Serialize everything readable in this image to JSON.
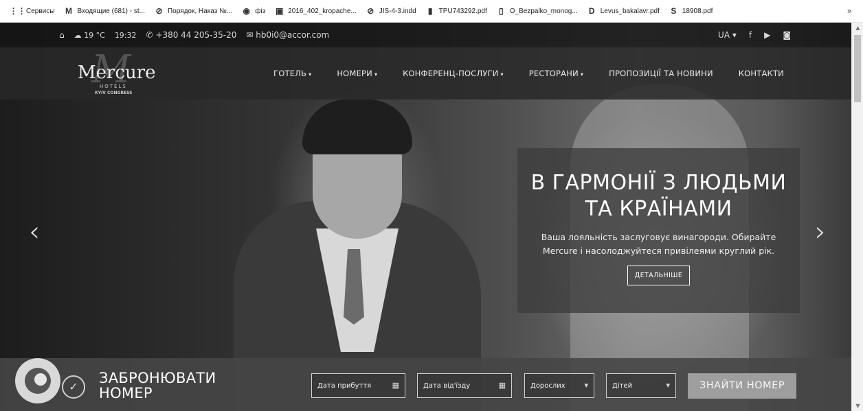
{
  "bookmarks": {
    "items": [
      {
        "label": "Сервисы",
        "icon": "apps-grid-icon",
        "glyph": "⋮⋮"
      },
      {
        "label": "Входящие (681) - st...",
        "icon": "gmail-icon",
        "glyph": "M"
      },
      {
        "label": "Порядок, Наказ №...",
        "icon": "globe-icon",
        "glyph": "⊘"
      },
      {
        "label": "фіз",
        "icon": "site-icon",
        "glyph": "◉"
      },
      {
        "label": "2016_402_kropache...",
        "icon": "image-icon",
        "glyph": "▣"
      },
      {
        "label": "JIS-4-3.indd",
        "icon": "globe-icon",
        "glyph": "⊘"
      },
      {
        "label": "TPU743292.pdf",
        "icon": "document-icon",
        "glyph": "▮"
      },
      {
        "label": "O_Bezpalko_monog...",
        "icon": "file-icon",
        "glyph": "▯"
      },
      {
        "label": "Levus_bakalavr.pdf",
        "icon": "pdf-icon",
        "glyph": "D"
      },
      {
        "label": "18908.pdf",
        "icon": "scribd-icon",
        "glyph": "S"
      }
    ],
    "more": "»"
  },
  "info_bar": {
    "home_glyph": "⌂",
    "weather": "19 °C",
    "time": "19:32",
    "phone": "+380 44 205-35-20",
    "email": "hb0i0@accor.com",
    "language": "UA ▾",
    "facebook": "f",
    "youtube": "▶",
    "instagram": "◙"
  },
  "logo": {
    "word": "Mercure",
    "hotels": "HOTELS",
    "location": "KYIV CONGRESS"
  },
  "menu": [
    {
      "label": "ГОТЕЛЬ",
      "caret": "▾"
    },
    {
      "label": "НОМЕРИ",
      "caret": "▾"
    },
    {
      "label": "КОНФЕРЕНЦ-ПОСЛУГИ",
      "caret": "▾"
    },
    {
      "label": "РЕСТОРАНИ",
      "caret": "▾"
    },
    {
      "label": "ПРОПОЗИЦІЇ ТА НОВИНИ",
      "caret": ""
    },
    {
      "label": "КОНТАКТИ",
      "caret": ""
    }
  ],
  "slider": {
    "prev": "‹",
    "next": "›"
  },
  "promo": {
    "title_line1": "В ГАРМОНІЇ З ЛЮДЬМИ",
    "title_line2": "ТА КРАЇНАМИ",
    "text_line1": "Ваша лояльність заслуговує винагороди. Обирайте",
    "text_line2": "Mercure і насолоджуйтеся привілеями круглий рік.",
    "button": "ДЕТАЛЬНІШЕ"
  },
  "booking": {
    "title_line1": "ЗАБРОНЮВАТИ",
    "title_line2": "НОМЕР",
    "arrival_placeholder": "Дата прибуття",
    "departure_placeholder": "Дата від'їзду",
    "adults": "Дорослих",
    "children": "Дітей",
    "submit": "ЗНАЙТИ НОМЕР"
  }
}
